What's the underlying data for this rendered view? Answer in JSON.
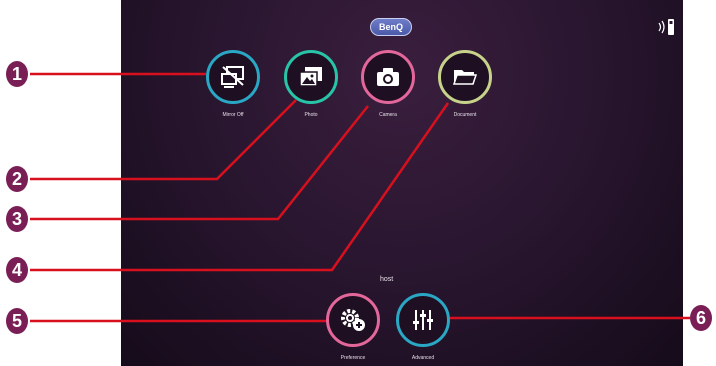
{
  "brand": {
    "logo_text": "BenQ"
  },
  "apps": [
    {
      "label": "Mirror Off",
      "icon": "mirror-off-icon",
      "ring": "#2aa7c4"
    },
    {
      "label": "Photo",
      "icon": "photo-icon",
      "ring": "#27c4a8"
    },
    {
      "label": "Camera",
      "icon": "camera-icon",
      "ring": "#e4679c"
    },
    {
      "label": "Document",
      "icon": "folder-icon",
      "ring": "#c7d38a"
    }
  ],
  "host_label": "host",
  "bottom_apps": [
    {
      "label": "Preference",
      "icon": "gear-plus-icon",
      "ring": "#e4679c"
    },
    {
      "label": "Advanced",
      "icon": "sliders-icon",
      "ring": "#2aa7c4"
    }
  ],
  "callouts": [
    "1",
    "2",
    "3",
    "4",
    "5",
    "6"
  ],
  "colors": {
    "callout": "#7a1f56",
    "leader_line": "#d8101e",
    "background": "#2a1630"
  }
}
